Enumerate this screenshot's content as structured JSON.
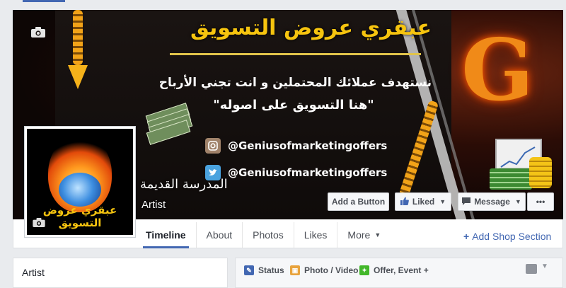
{
  "cover": {
    "headline": "عبقري عروض التسويق",
    "subline": "نستهدف عملائك المحتملين و انت تجني الأرباح",
    "subline2": "\"هنا التسويق على اصوله\"",
    "instagram_handle": "@Geniusofmarketingoffers",
    "twitter_handle": "@Geniusofmarketingoffers",
    "letter": "G",
    "camera_icon": "camera-icon"
  },
  "profile": {
    "picture_text": "عبقري عروض التسويق",
    "name": "المدرسة القديمة",
    "category": "Artist"
  },
  "actions": {
    "add_button": "Add a Button",
    "liked": "Liked",
    "message": "Message",
    "more": "•••"
  },
  "tabs": [
    {
      "label": "Timeline"
    },
    {
      "label": "About"
    },
    {
      "label": "Photos"
    },
    {
      "label": "Likes"
    },
    {
      "label": "More"
    }
  ],
  "add_shop": "Add Shop Section",
  "sidebar": {
    "category": "Artist"
  },
  "composer": {
    "status": "Status",
    "photo_video": "Photo / Video",
    "offer_event": "Offer, Event +"
  },
  "colors": {
    "accent": "#4267b2",
    "headline_gold": "#f6c40f"
  }
}
